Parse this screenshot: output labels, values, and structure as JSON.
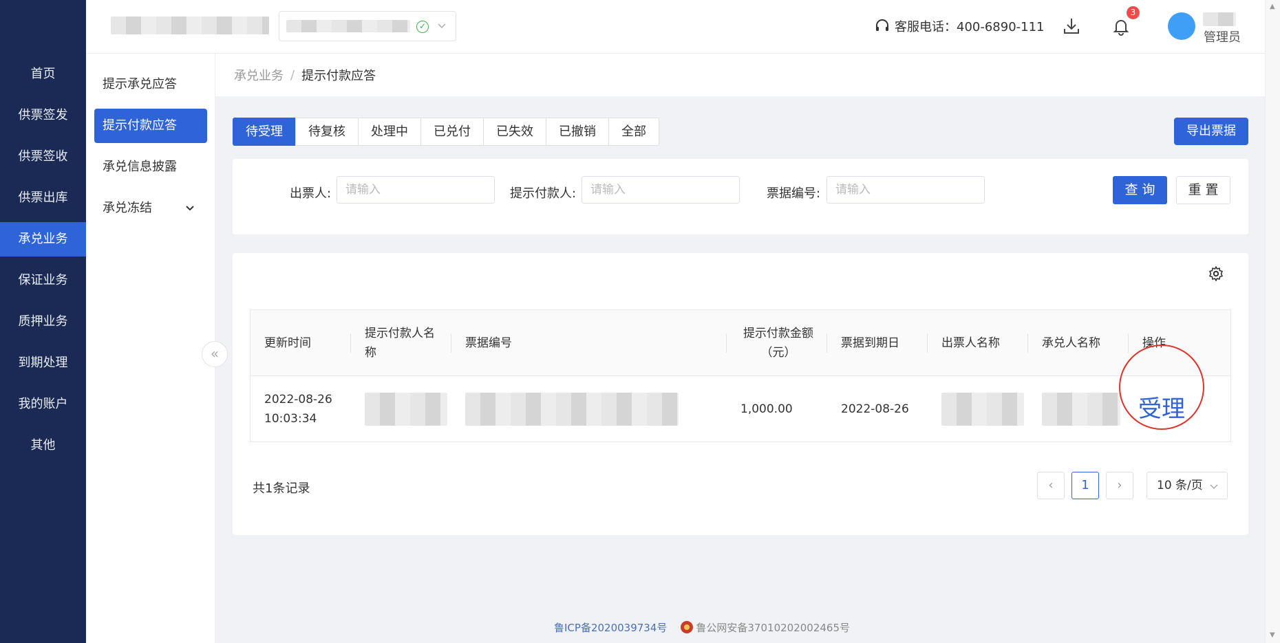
{
  "left_nav": {
    "items": [
      {
        "label": "首页",
        "active": false
      },
      {
        "label": "供票签发",
        "active": false
      },
      {
        "label": "供票签收",
        "active": false
      },
      {
        "label": "供票出库",
        "active": false
      },
      {
        "label": "承兑业务",
        "active": true
      },
      {
        "label": "保证业务",
        "active": false
      },
      {
        "label": "质押业务",
        "active": false
      },
      {
        "label": "到期处理",
        "active": false
      },
      {
        "label": "我的账户",
        "active": false
      },
      {
        "label": "其他",
        "active": false
      }
    ]
  },
  "header": {
    "hotline_label": "客服电话：400-6890-111",
    "notification_count": "3",
    "role": "管理员"
  },
  "sub_nav": {
    "items": [
      {
        "label": "提示承兑应答",
        "active": false
      },
      {
        "label": "提示付款应答",
        "active": true
      },
      {
        "label": "承兑信息披露",
        "active": false
      },
      {
        "label": "承兑冻结",
        "active": false
      }
    ],
    "collapse_label": "«"
  },
  "breadcrumb": {
    "parent": "承兑业务",
    "separator": "/",
    "current": "提示付款应答"
  },
  "tabs": [
    {
      "label": "待受理",
      "active": true
    },
    {
      "label": "待复核",
      "active": false
    },
    {
      "label": "处理中",
      "active": false
    },
    {
      "label": "已兑付",
      "active": false
    },
    {
      "label": "已失效",
      "active": false
    },
    {
      "label": "已撤销",
      "active": false
    },
    {
      "label": "全部",
      "active": false
    }
  ],
  "export_label": "导出票据",
  "filters": {
    "drawer_label": "出票人:",
    "drawer_placeholder": "请输入",
    "payee_label": "提示付款人:",
    "payee_placeholder": "请输入",
    "bill_no_label": "票据编号:",
    "bill_no_placeholder": "请输入",
    "query_label": "查 询",
    "reset_label": "重 置"
  },
  "table": {
    "columns": [
      "更新时间",
      "提示付款人名称",
      "票据编号",
      "提示付款金额（元）",
      "票据到期日",
      "出票人名称",
      "承兑人名称",
      "操作"
    ],
    "rows": [
      {
        "updated_time": "2022-08-26 10:03:34",
        "amount": "1,000.00",
        "due_date": "2022-08-26",
        "action": "受理"
      }
    ]
  },
  "pagination": {
    "total_label": "共1条记录",
    "prev": "‹",
    "current_page": "1",
    "next": "›",
    "page_size": "10 条/页"
  },
  "footer": {
    "icp": "鲁ICP备2020039734号",
    "police": "鲁公网安备37010202002465号"
  },
  "colors": {
    "sidebar_bg": "#1b2a55",
    "primary": "#2f64d8",
    "highlight_circle": "#e0312a"
  }
}
